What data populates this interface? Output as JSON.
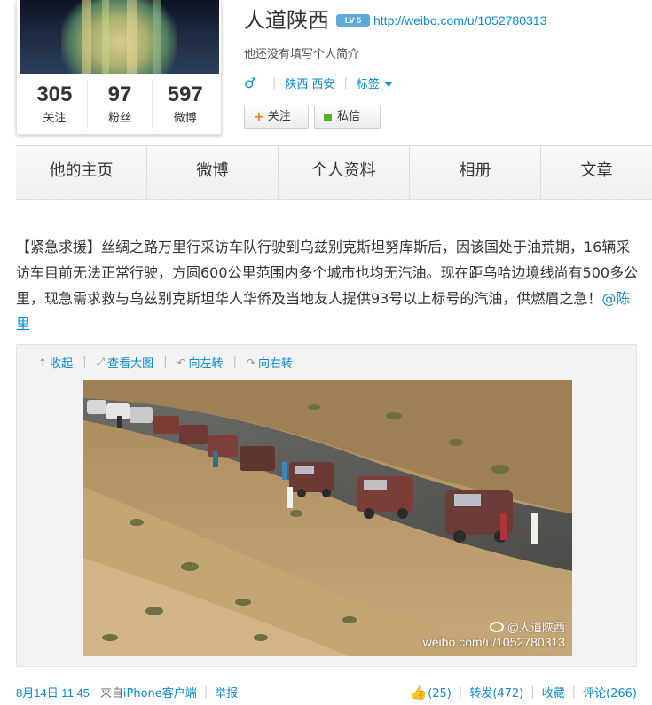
{
  "profile": {
    "name": "人道陕西",
    "level_badge": "LV 5",
    "home_url": "http://weibo.com/u/1052780313",
    "bio": "他还没有填写个人简介",
    "gender_icon": "male-icon",
    "location": "陕西 西安",
    "tags_label": "标签",
    "stats": [
      {
        "count": "305",
        "label": "关注"
      },
      {
        "count": "97",
        "label": "粉丝"
      },
      {
        "count": "597",
        "label": "微博"
      }
    ],
    "follow_label": "关注",
    "message_label": "私信",
    "colors": {
      "link": "#0a8cd2",
      "follow_plus": "#f37b1d",
      "message_square": "#58b02d",
      "badge": "#5fa9d9"
    }
  },
  "tabs": [
    {
      "label": "他的主页"
    },
    {
      "label": "微博"
    },
    {
      "label": "个人资料"
    },
    {
      "label": "相册"
    },
    {
      "label": "文章"
    }
  ],
  "post": {
    "text": "【紧急求援】丝绸之路万里行采访车队行驶到乌兹别克斯坦努库斯后，因该国处于油荒期，16辆采访车目前无法正常行驶，方圆600公里范围内多个城市也均无汽油。现在距乌哈边境线尚有500多公里，现急需求救与乌兹别克斯坦华人华侨及当地友人提供93号以上标号的汽油，供燃眉之急！",
    "mention": "@陈里",
    "media_tools": [
      "收起",
      "查看大图",
      "向左转",
      "向右转"
    ],
    "watermark_line1": "@人道陕西",
    "watermark_line2": "weibo.com/u/1052780313",
    "time": "8月14日 11:45",
    "source_prefix": "来自",
    "source": "iPhone客户端",
    "report": "举报",
    "likes": "(25)",
    "repost": "转发(472)",
    "favorite": "收藏",
    "comment": "评论(266)"
  }
}
